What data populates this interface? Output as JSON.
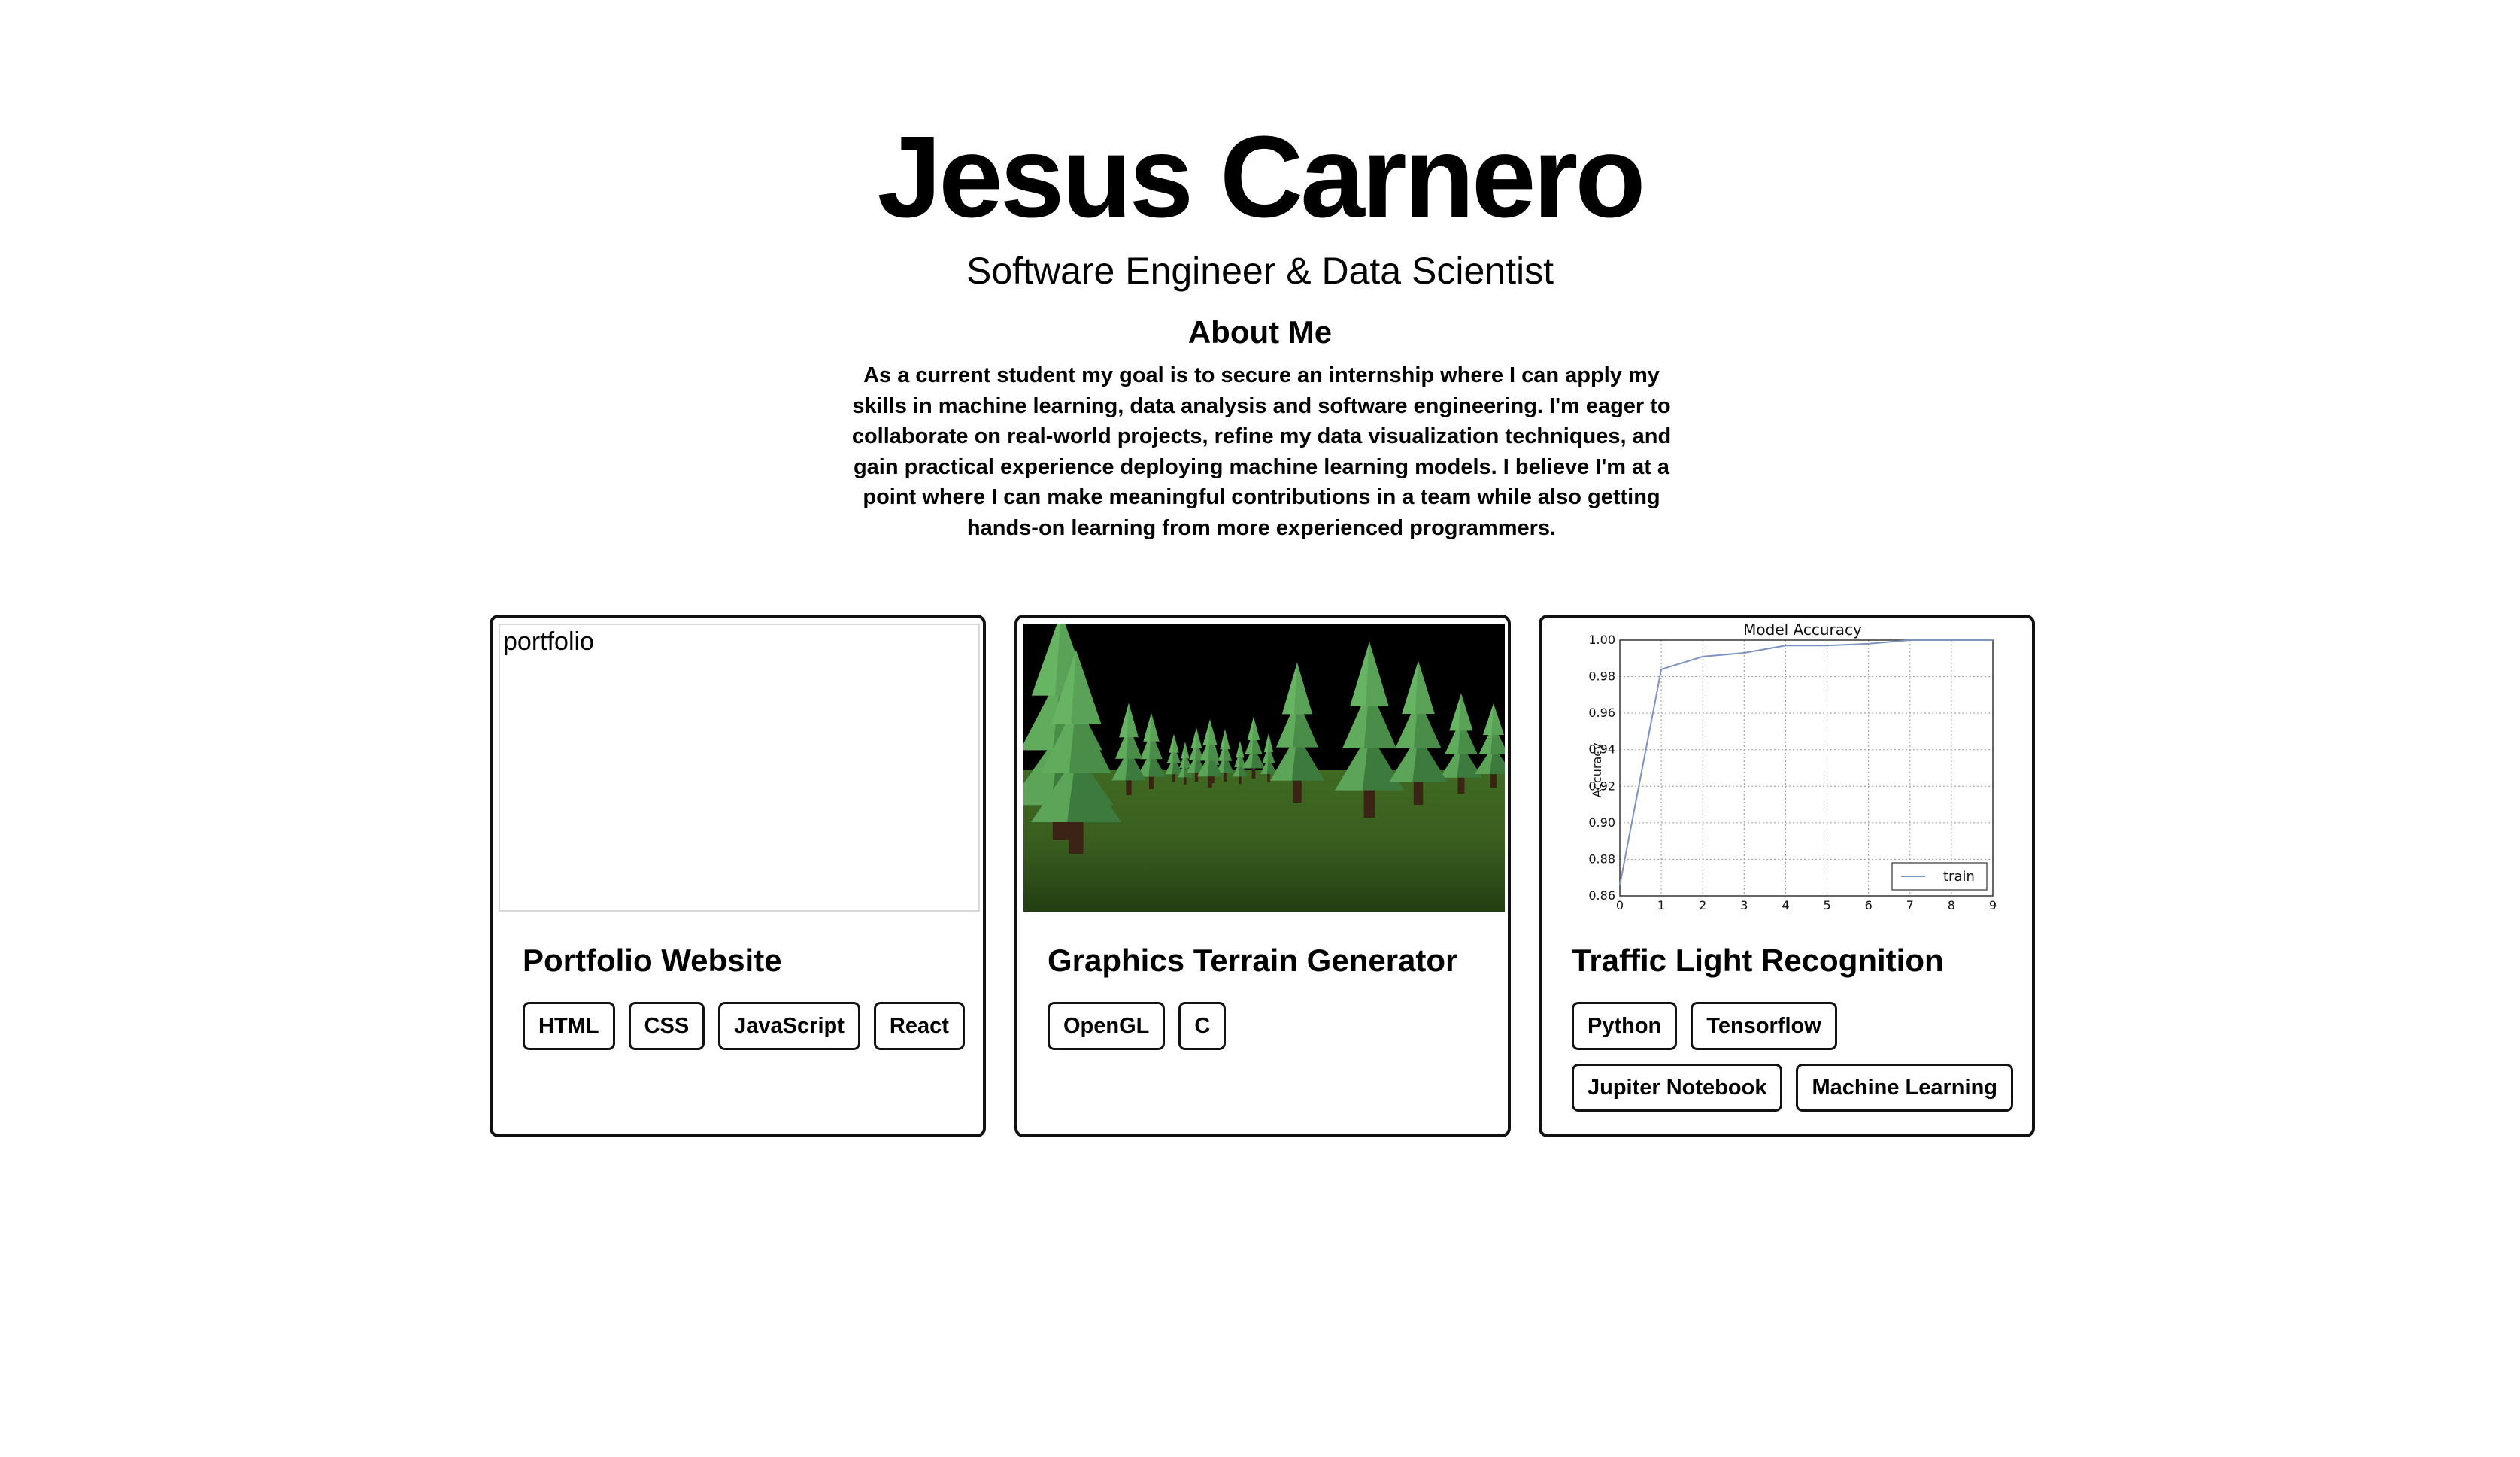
{
  "header": {
    "name": "Jesus Carnero",
    "subtitle": "Software Engineer & Data Scientist"
  },
  "about": {
    "title": "About Me",
    "text": "As a current student my goal is to secure an internship where I can apply my skills in machine learning, data analysis and software engineering. I'm eager to collaborate on real-world projects, refine my data visualization techniques, and gain practical experience deploying machine learning models. I believe I'm at a point where I can make meaningful contributions in a team while also getting hands-on learning from more experienced programmers."
  },
  "projects": [
    {
      "title": "Portfolio Website",
      "image_alt": "portfolio",
      "tags": [
        "HTML",
        "CSS",
        "JavaScript",
        "React"
      ]
    },
    {
      "title": "Graphics Terrain Generator",
      "tags": [
        "OpenGL",
        "C"
      ]
    },
    {
      "title": "Traffic Light Recognition",
      "tags": [
        "Python",
        "Tensorflow",
        "Jupiter Notebook",
        "Machine Learning"
      ]
    }
  ],
  "chart_data": {
    "type": "line",
    "title": "Model Accuracy",
    "xlabel": "",
    "ylabel": "Accuracy",
    "x": [
      0,
      1,
      2,
      3,
      4,
      5,
      6,
      7,
      8,
      9
    ],
    "series": [
      {
        "name": "train",
        "values": [
          0.866,
          0.984,
          0.991,
          0.993,
          0.997,
          0.997,
          0.998,
          1.0,
          1.0,
          1.0
        ]
      }
    ],
    "xlim": [
      0,
      9
    ],
    "ylim": [
      0.86,
      1.0
    ],
    "xticks": [
      "0",
      "1",
      "2",
      "3",
      "4",
      "5",
      "6",
      "7",
      "8",
      "9"
    ],
    "yticks": [
      "0.86",
      "0.88",
      "0.90",
      "0.92",
      "0.94",
      "0.96",
      "0.98",
      "1.00"
    ],
    "grid": true,
    "legend_position": "lower-right",
    "line_color": "#7b93bf"
  }
}
